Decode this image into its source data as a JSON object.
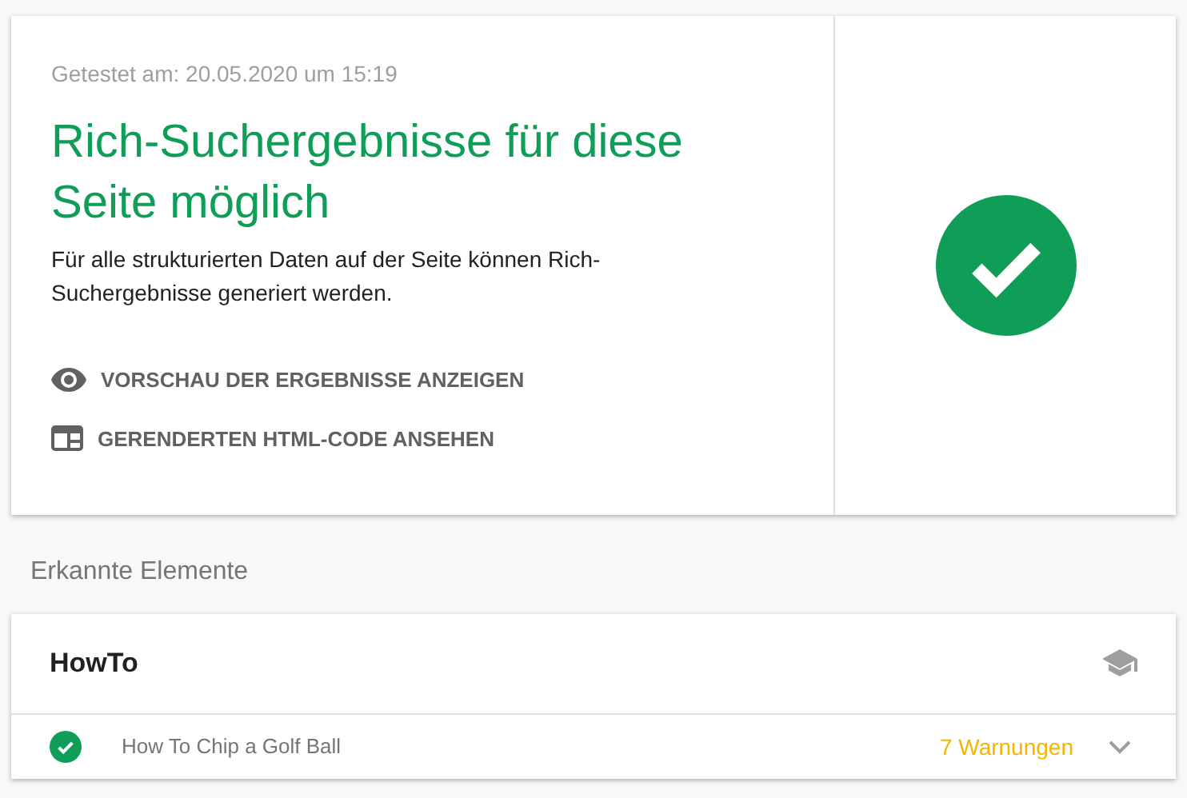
{
  "result": {
    "tested_at": "Getestet am: 20.05.2020 um 15:19",
    "heading": "Rich-Suchergebnisse für diese Seite möglich",
    "description": "Für alle strukturierten Daten auf der Seite können Rich-Suchergebnisse generiert werden.",
    "valid": true,
    "actions": [
      {
        "kind": "preview",
        "label": "VORSCHAU DER ERGEBNISSE ANZEIGEN"
      },
      {
        "kind": "html",
        "label": "GERENDERTEN HTML-CODE ANSEHEN"
      }
    ]
  },
  "section_title": "Erkannte Elemente",
  "detected": {
    "title": "HowTo",
    "items": [
      {
        "valid": true,
        "name": "How To Chip a Golf Ball",
        "warnings": "7 Warnungen",
        "expanded": false
      }
    ]
  }
}
